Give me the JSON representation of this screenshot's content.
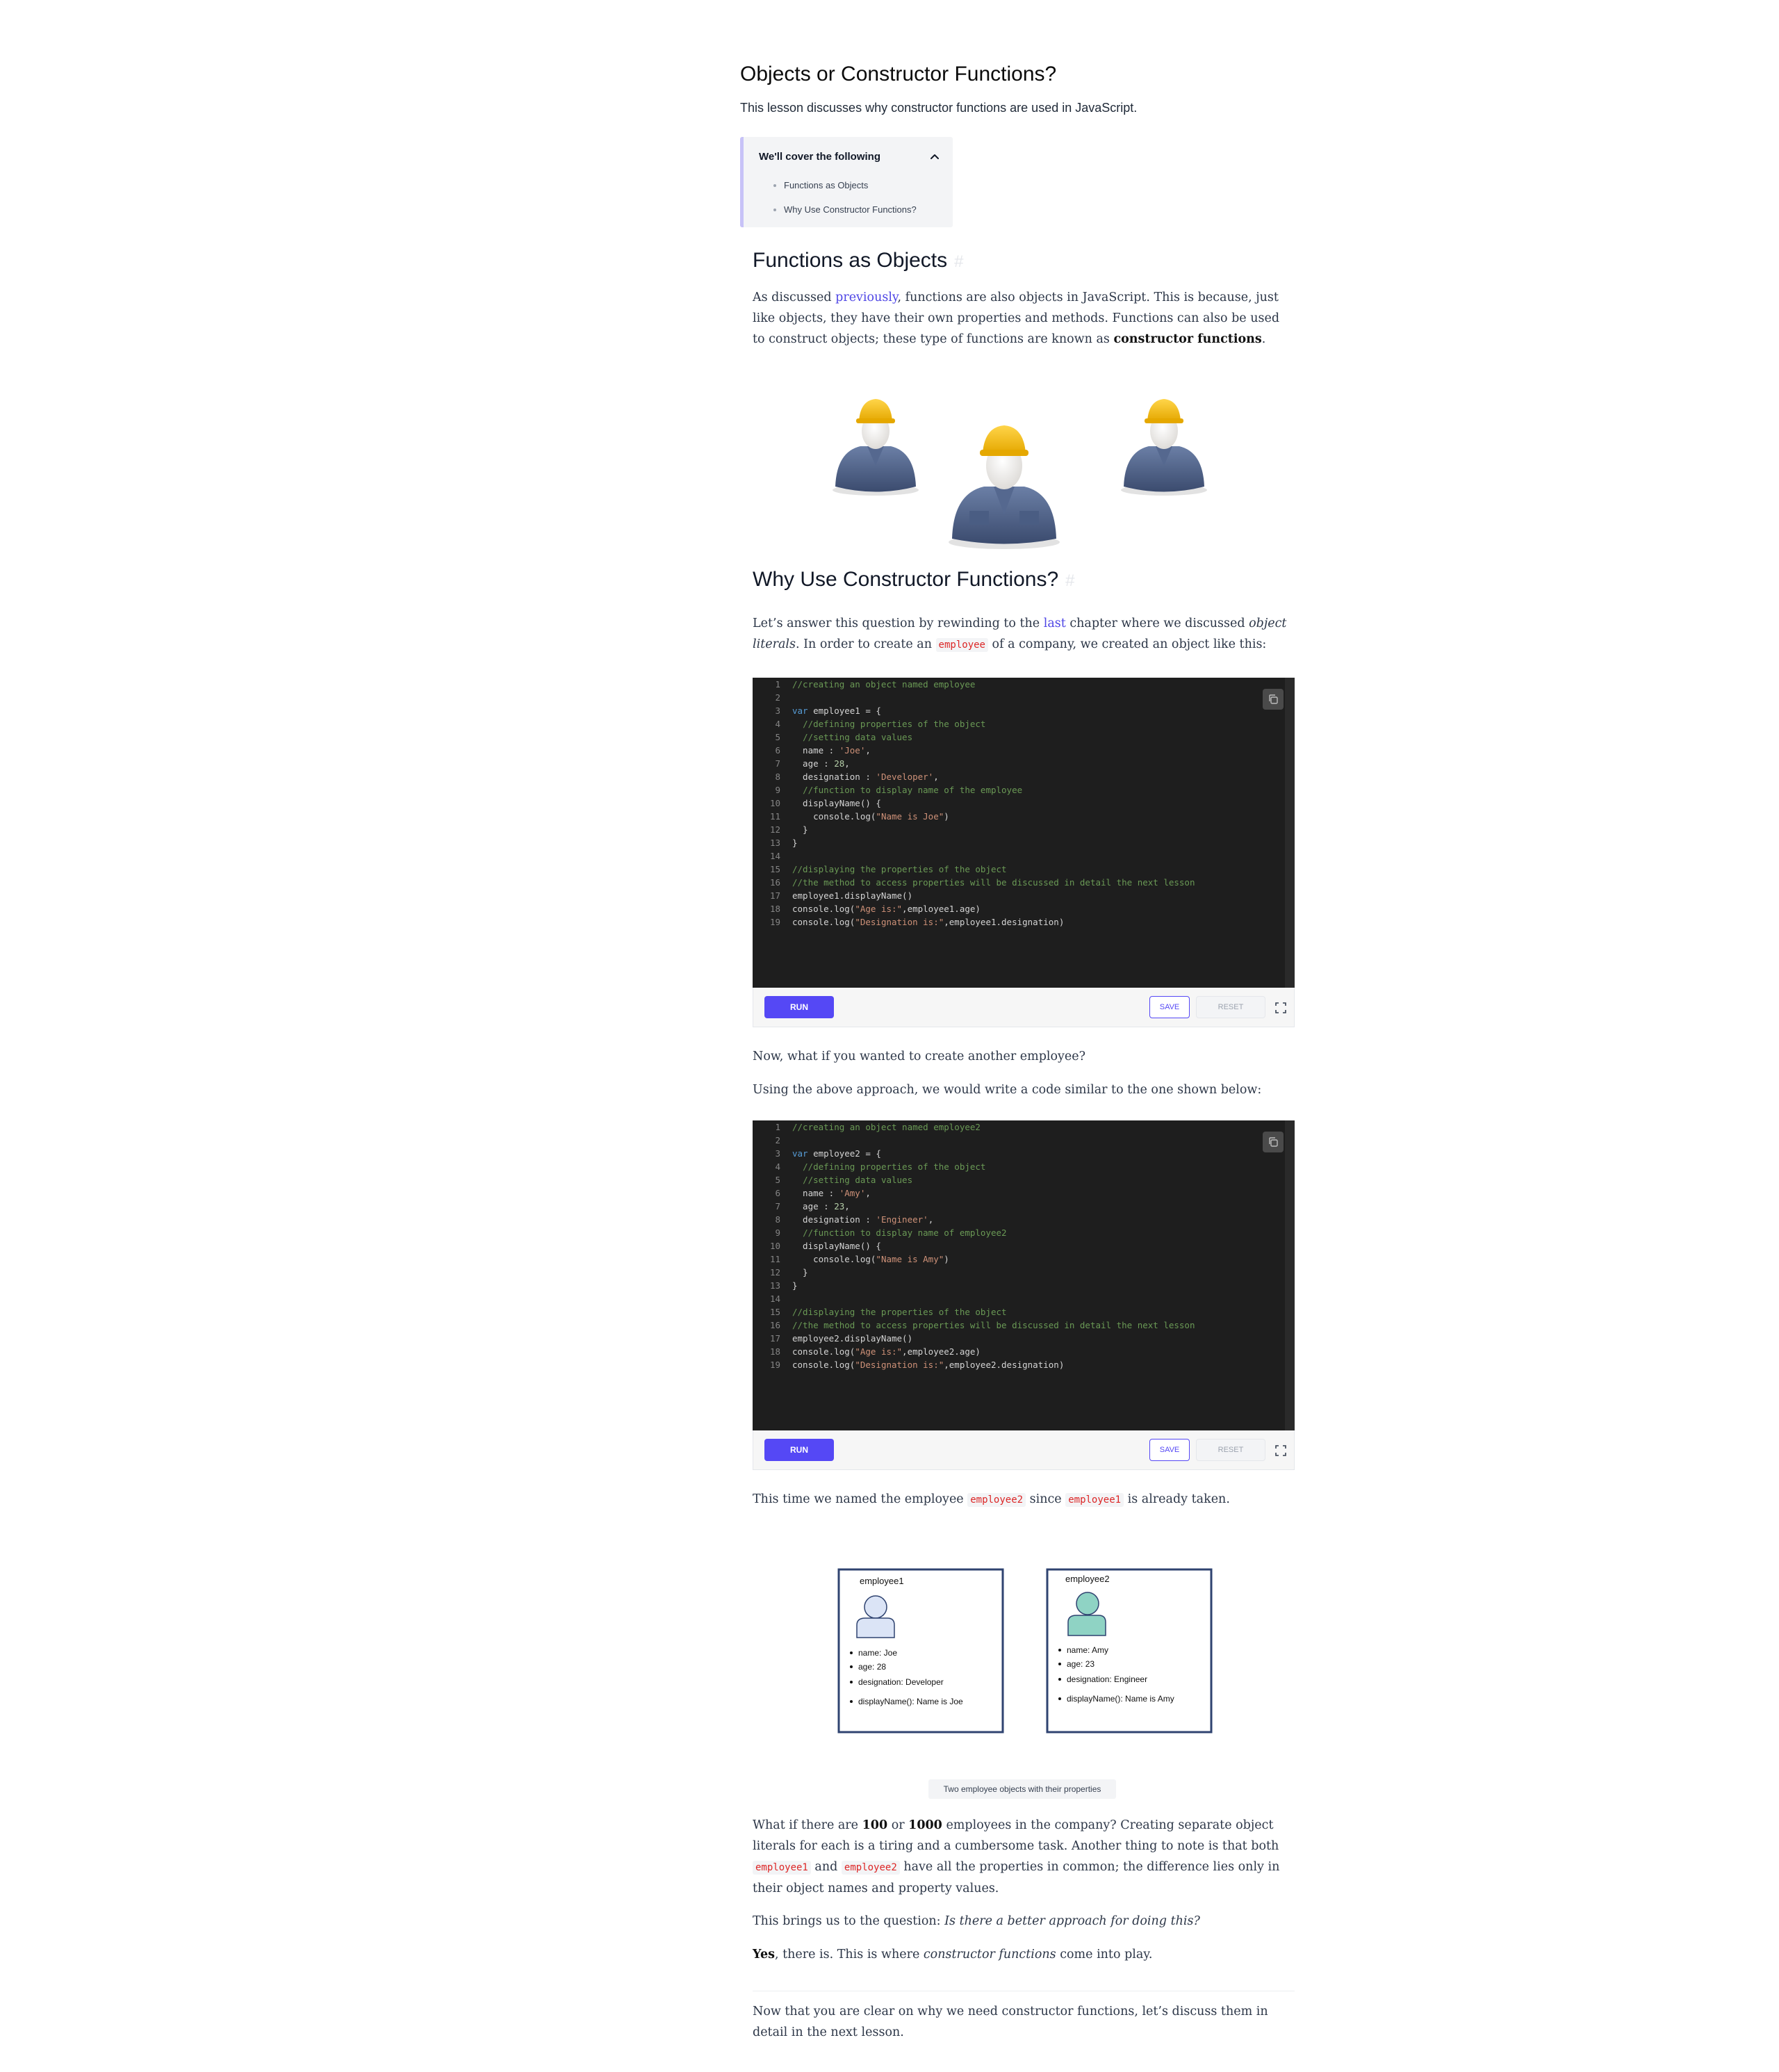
{
  "page": {
    "title": "Objects or Constructor Functions?",
    "subtitle": "This lesson discusses why constructor functions are used in JavaScript."
  },
  "toc": {
    "header": "We'll cover the following",
    "items": [
      "Functions as Objects",
      "Why Use Constructor Functions?"
    ]
  },
  "section1": {
    "heading": "Functions as Objects",
    "p1_before": "As discussed ",
    "p1_link": "previously",
    "p1_mid": ", functions are also objects in JavaScript. This is because, just like objects, they have their own properties and methods. Functions can also be used to construct objects; these type of functions are known as ",
    "p1_bold": "constructor functions",
    "p1_after": "."
  },
  "section2": {
    "heading": "Why Use Constructor Functions?",
    "p1_a": "Let’s answer this question by rewinding to the ",
    "p1_link": "last",
    "p1_b": " chapter where we discussed ",
    "p1_em": "object literals",
    "p1_c": ". In order to create an ",
    "p1_code": "employee",
    "p1_d": " of a company, we created an object like this:",
    "p2": "Now, what if you wanted to create another employee?",
    "p3": "Using the above approach, we would write a code similar to the one shown below:",
    "p4_a": "This time we named the employee ",
    "p4_code1": "employee2",
    "p4_b": " since ",
    "p4_code2": "employee1",
    "p4_c": " is already taken.",
    "p5_a": "What if there are ",
    "p5_b1": "100",
    "p5_or": " or ",
    "p5_b2": "1000",
    "p5_b": " employees in the company? Creating separate object literals for each is a tiring and a cumbersome task. Another thing to note is that both ",
    "p5_code1": "employee1",
    "p5_and": " and ",
    "p5_code2": "employee2",
    "p5_c": " have all the properties in common; the difference lies only in their object names and property values.",
    "p6_a": "This brings us to the question: ",
    "p6_em": "Is there a better approach for doing this?",
    "p7_bold": "Yes",
    "p7_a": ", there is. This is where ",
    "p7_em": "constructor functions",
    "p7_b": " come into play.",
    "p8": "Now that you are clear on why we need constructor functions, let’s discuss them in detail in the next lesson."
  },
  "editor_buttons": {
    "run": "RUN",
    "save": "SAVE",
    "reset": "RESET"
  },
  "code1": [
    [
      [
        "comment",
        "//creating an object named employee"
      ]
    ],
    [],
    [
      [
        "keyword",
        "var"
      ],
      [
        "plain",
        " employee1 = {"
      ]
    ],
    [
      [
        "plain",
        "  "
      ],
      [
        "comment",
        "//defining properties of the object"
      ]
    ],
    [
      [
        "plain",
        "  "
      ],
      [
        "comment",
        "//setting data values"
      ]
    ],
    [
      [
        "plain",
        "  name : "
      ],
      [
        "string",
        "'Joe'"
      ],
      [
        "plain",
        ","
      ]
    ],
    [
      [
        "plain",
        "  age : "
      ],
      [
        "number",
        "28"
      ],
      [
        "plain",
        ","
      ]
    ],
    [
      [
        "plain",
        "  designation : "
      ],
      [
        "string",
        "'Developer'"
      ],
      [
        "plain",
        ","
      ]
    ],
    [
      [
        "plain",
        "  "
      ],
      [
        "comment",
        "//function to display name of the employee"
      ]
    ],
    [
      [
        "plain",
        "  displayName() {"
      ]
    ],
    [
      [
        "plain",
        "    console.log("
      ],
      [
        "string",
        "\"Name is Joe\""
      ],
      [
        "plain",
        ")"
      ]
    ],
    [
      [
        "plain",
        "  }"
      ]
    ],
    [
      [
        "plain",
        "}"
      ]
    ],
    [],
    [
      [
        "comment",
        "//displaying the properties of the object"
      ]
    ],
    [
      [
        "comment",
        "//the method to access properties will be discussed in detail the next lesson"
      ]
    ],
    [
      [
        "plain",
        "employee1.displayName()"
      ]
    ],
    [
      [
        "plain",
        "console.log("
      ],
      [
        "string",
        "\"Age is:\""
      ],
      [
        "plain",
        ",employee1.age)"
      ]
    ],
    [
      [
        "plain",
        "console.log("
      ],
      [
        "string",
        "\"Designation is:\""
      ],
      [
        "plain",
        ",employee1.designation)"
      ]
    ]
  ],
  "code2": [
    [
      [
        "comment",
        "//creating an object named employee2"
      ]
    ],
    [],
    [
      [
        "keyword",
        "var"
      ],
      [
        "plain",
        " employee2 = {"
      ]
    ],
    [
      [
        "plain",
        "  "
      ],
      [
        "comment",
        "//defining properties of the object"
      ]
    ],
    [
      [
        "plain",
        "  "
      ],
      [
        "comment",
        "//setting data values"
      ]
    ],
    [
      [
        "plain",
        "  name : "
      ],
      [
        "string",
        "'Amy'"
      ],
      [
        "plain",
        ","
      ]
    ],
    [
      [
        "plain",
        "  age : "
      ],
      [
        "number",
        "23"
      ],
      [
        "plain",
        ","
      ]
    ],
    [
      [
        "plain",
        "  designation : "
      ],
      [
        "string",
        "'Engineer'"
      ],
      [
        "plain",
        ","
      ]
    ],
    [
      [
        "plain",
        "  "
      ],
      [
        "comment",
        "//function to display name of employee2"
      ]
    ],
    [
      [
        "plain",
        "  displayName() {"
      ]
    ],
    [
      [
        "plain",
        "    console.log("
      ],
      [
        "string",
        "\"Name is Amy\""
      ],
      [
        "plain",
        ")"
      ]
    ],
    [
      [
        "plain",
        "  }"
      ]
    ],
    [
      [
        "plain",
        "}"
      ]
    ],
    [],
    [
      [
        "comment",
        "//displaying the properties of the object"
      ]
    ],
    [
      [
        "comment",
        "//the method to access properties will be discussed in detail the next lesson"
      ]
    ],
    [
      [
        "plain",
        "employee2.displayName()"
      ]
    ],
    [
      [
        "plain",
        "console.log("
      ],
      [
        "string",
        "\"Age is:\""
      ],
      [
        "plain",
        ",employee2.age)"
      ]
    ],
    [
      [
        "plain",
        "console.log("
      ],
      [
        "string",
        "\"Designation is:\""
      ],
      [
        "plain",
        ",employee2.designation)"
      ]
    ]
  ],
  "diagram": {
    "card1": {
      "title": "employee1",
      "props": [
        "name: Joe",
        "age: 28",
        "designation: Developer",
        "displayName(): Name is Joe"
      ]
    },
    "card2": {
      "title": "employee2",
      "props": [
        "name: Amy",
        " age: 23",
        "designation: Engineer",
        "displayName(): Name is Amy"
      ]
    },
    "caption": "Two employee objects with their properties"
  },
  "colors": {
    "accent": "#5548f5",
    "link": "#4f46e5",
    "inline_code": "#dc2626",
    "card1_avatar": "#dbe4f6",
    "card2_avatar": "#8fd3c4",
    "card_border": "#2f4370"
  }
}
